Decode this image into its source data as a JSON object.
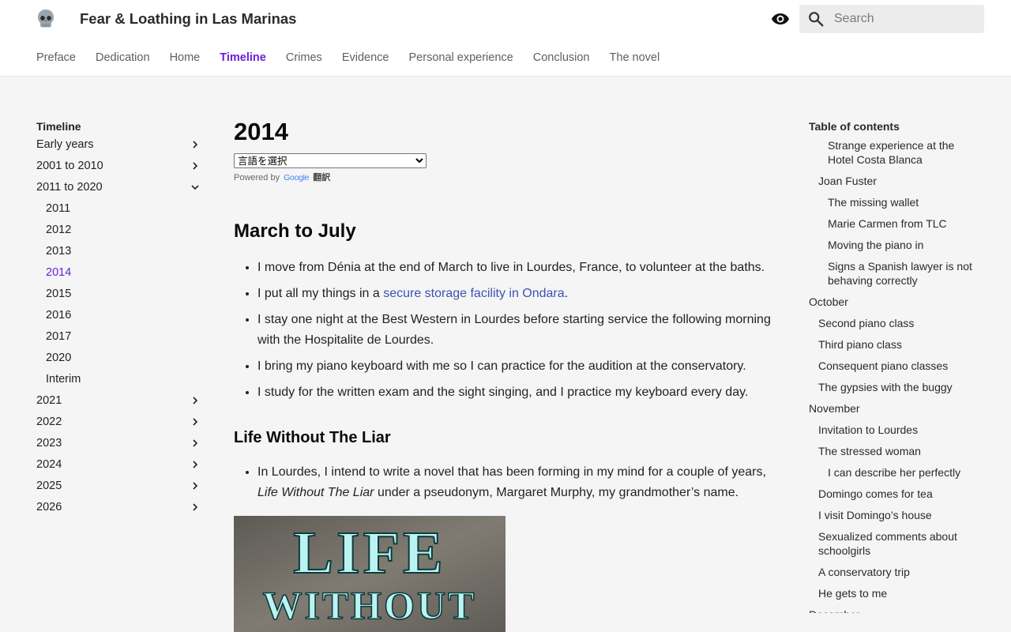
{
  "site": {
    "title": "Fear & Loathing in Las Marinas"
  },
  "search": {
    "placeholder": "Search"
  },
  "tabs": [
    {
      "label": "Preface"
    },
    {
      "label": "Dedication"
    },
    {
      "label": "Home"
    },
    {
      "label": "Timeline",
      "active": true
    },
    {
      "label": "Crimes"
    },
    {
      "label": "Evidence"
    },
    {
      "label": "Personal experience"
    },
    {
      "label": "Conclusion"
    },
    {
      "label": "The novel"
    }
  ],
  "sidebar": {
    "title": "Timeline",
    "items": [
      {
        "label": "Early years"
      },
      {
        "label": "2001 to 2010"
      },
      {
        "label": "2011 to 2020"
      },
      {
        "label": "2011"
      },
      {
        "label": "2012"
      },
      {
        "label": "2013"
      },
      {
        "label": "2014"
      },
      {
        "label": "2015"
      },
      {
        "label": "2016"
      },
      {
        "label": "2017"
      },
      {
        "label": "2020"
      },
      {
        "label": "Interim"
      },
      {
        "label": "2021"
      },
      {
        "label": "2022"
      },
      {
        "label": "2023"
      },
      {
        "label": "2024"
      },
      {
        "label": "2025"
      },
      {
        "label": "2026"
      }
    ]
  },
  "main": {
    "title": "2014",
    "language_select": "言語を選択",
    "powered_by": "Powered by",
    "google": "Google",
    "translate": "翻訳",
    "section1": {
      "heading": "March to July",
      "items": [
        "I move from Dénia at the end of March to live in Lourdes, France, to volunteer at the baths.",
        "I put all my things in a",
        "secure storage facility in Ondara",
        ".",
        "I stay one night at the Best Western in Lourdes before starting service the following morning with the Hospitalite de Lourdes.",
        "I bring my piano keyboard with me so I can practice for the audition at the conservatory.",
        "I study for the written exam and the sight singing, and I practice my keyboard every day."
      ]
    },
    "section2": {
      "heading": "Life Without The Liar",
      "item_start": "In Lourdes, I intend to write a novel that has been forming in my mind for a couple of years,",
      "item_title": "Life Without The Liar",
      "item_end": "under a pseudonym, Margaret Murphy, my grandmother’s name."
    },
    "cover": {
      "line1": "LIFE",
      "line2": "WITHOUT"
    }
  },
  "toc": {
    "title": "Table of contents",
    "items": [
      "Strange experience at the Hotel Costa Blanca",
      "Joan Fuster",
      "The missing wallet",
      "Marie Carmen from TLC",
      "Moving the piano in",
      "Signs a Spanish lawyer is not behaving correctly",
      "October",
      "Second piano class",
      "Third piano class",
      "Consequent piano classes",
      "The gypsies with the buggy",
      "November",
      "Invitation to Lourdes",
      "The stressed woman",
      "I can describe her perfectly",
      "Domingo comes for tea",
      "I visit Domingo’s house",
      "Sexualized comments about schoolgirls",
      "A conservatory trip",
      "He gets to me",
      "December"
    ]
  },
  "colors": {
    "accent": "#6a1fd8",
    "link": "#3f51b5"
  },
  "icons": [
    "skull-icon",
    "eye-icon",
    "search-icon",
    "chevron-right-icon",
    "chevron-down-icon"
  ]
}
